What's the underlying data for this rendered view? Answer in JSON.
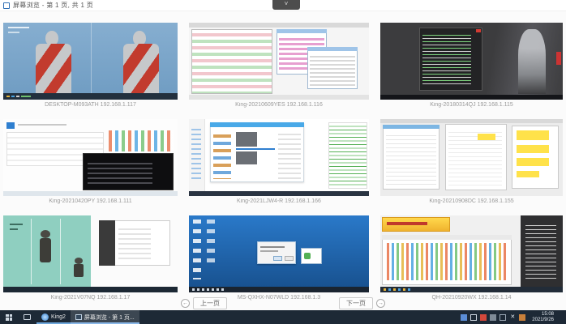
{
  "window": {
    "title": "屏幕浏览 - 第 1 页, 共 1 页"
  },
  "icons": {
    "chevron_down": "˅",
    "arrow_left": "←",
    "arrow_right": "→"
  },
  "grid": {
    "tiles": [
      {
        "machine": "DESKTOP-M093ATH",
        "ip": "192.168.1.117",
        "caption": "DESKTOP-M093ATH 192.168.1.117"
      },
      {
        "machine": "King-20210609YES",
        "ip": "192.168.1.116",
        "caption": "King-20210609YES 192.168.1.116"
      },
      {
        "machine": "King-20180314QJ",
        "ip": "192.168.1.115",
        "caption": "King-20180314QJ 192.168.1.115"
      },
      {
        "machine": "King-20210420PY",
        "ip": "192.168.1.111",
        "caption": "King-20210420PY 192.168.1.111"
      },
      {
        "machine": "King-2021LJW4-R",
        "ip": "192.168.1.166",
        "caption": "King-2021LJW4-R 192.168.1.166"
      },
      {
        "machine": "King-20210908DC",
        "ip": "192.168.1.155",
        "caption": "King-20210908DC 192.168.1.155"
      },
      {
        "machine": "King-2021V07NQ",
        "ip": "192.168.1.17",
        "caption": "King-2021V07NQ 192.168.1.17"
      },
      {
        "machine": "MS-QXHX-N07WLD",
        "ip": "192.168.1.3",
        "caption": "MS-QXHX-N07WLD 192.168.1.3"
      },
      {
        "machine": "QH-20210920WX",
        "ip": "192.168.1.14",
        "caption": "QH-20210920WX 192.168.1.14"
      }
    ]
  },
  "pagination": {
    "prev_label": "上一页",
    "next_label": "下一页"
  },
  "taskbar": {
    "pinned_app_label": "King2",
    "active_app_label": "屏幕浏览 - 第 1 页...",
    "tray": {
      "time": "15:08",
      "date": "2021/9/26"
    }
  },
  "colors": {
    "taskbar_bg": "#1d2936",
    "accent_blue": "#2f7fd0",
    "highlight_yellow": "#ffe24a"
  }
}
